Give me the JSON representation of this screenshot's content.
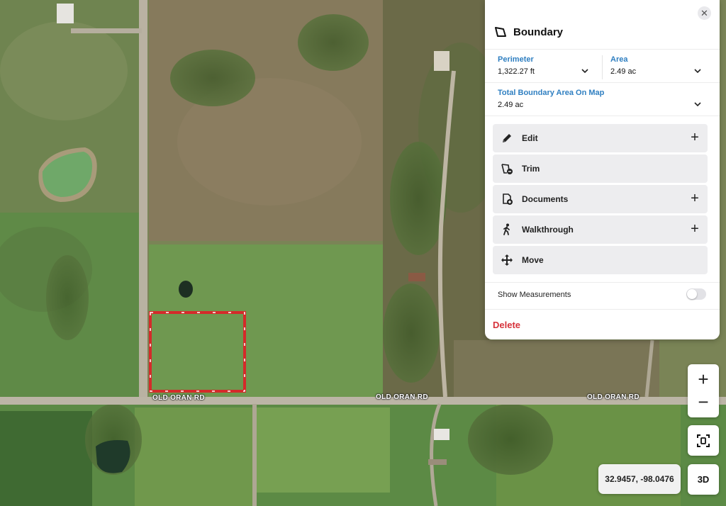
{
  "map": {
    "road_labels": [
      "OLD ORAN RD",
      "OLD ORAN RD",
      "OLD ORAN RD"
    ],
    "boundary_color": "#d42a2a"
  },
  "panel": {
    "title": "Boundary",
    "close_icon": "close-icon",
    "perimeter": {
      "label": "Perimeter",
      "value": "1,322.27 ft"
    },
    "area": {
      "label": "Area",
      "value": "2.49 ac"
    },
    "total_area": {
      "label": "Total Boundary Area On Map",
      "value": "2.49 ac"
    },
    "actions": [
      {
        "label": "Edit",
        "icon": "pencil-icon",
        "has_plus": true
      },
      {
        "label": "Trim",
        "icon": "trim-icon",
        "has_plus": false
      },
      {
        "label": "Documents",
        "icon": "document-add-icon",
        "has_plus": true
      },
      {
        "label": "Walkthrough",
        "icon": "walking-person-icon",
        "has_plus": true
      },
      {
        "label": "Move",
        "icon": "move-arrows-icon",
        "has_plus": false
      }
    ],
    "show_measurements": {
      "label": "Show Measurements",
      "enabled": false
    },
    "delete_label": "Delete",
    "accent_color": "#2f7fc1",
    "danger_color": "#d6323a"
  },
  "controls": {
    "zoom_in": "+",
    "zoom_out": "−",
    "recenter_icon": "focus-frame-icon",
    "coordinates": "32.9457, -98.0476",
    "view_3d": "3D"
  }
}
